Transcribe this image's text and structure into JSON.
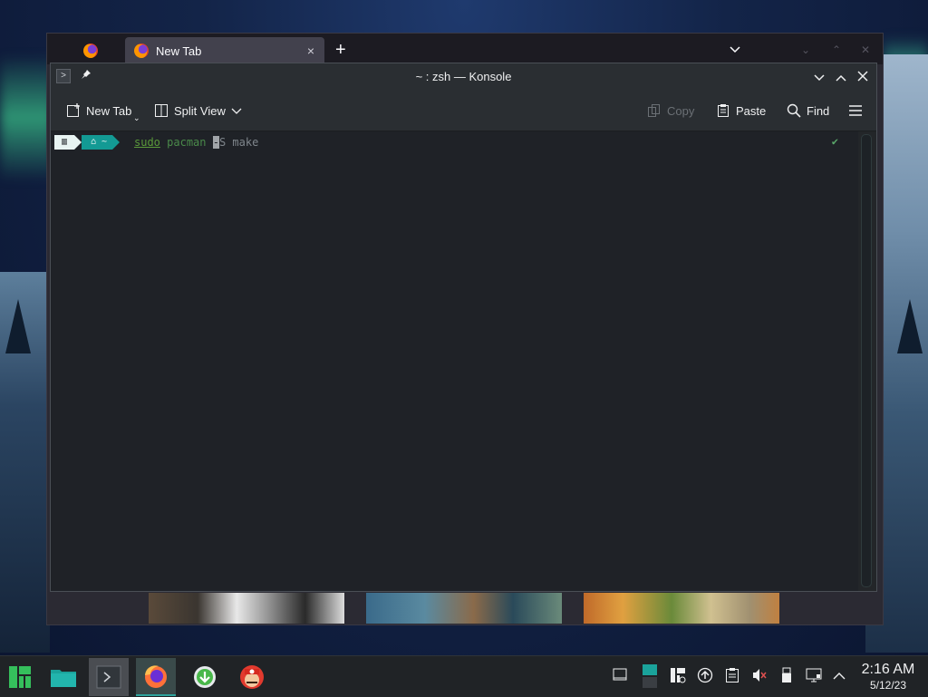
{
  "firefox": {
    "active_tab_label": "New Tab",
    "close_glyph": "×",
    "newtab_glyph": "+",
    "dropdown_glyph": "⌄"
  },
  "konsole": {
    "title": "~ : zsh — Konsole",
    "toolbar": {
      "new_tab_label": "New Tab",
      "split_view_label": "Split View",
      "copy_label": "Copy",
      "paste_label": "Paste",
      "find_label": "Find"
    },
    "terminal": {
      "prompt_home": "⌂ ~",
      "command_sudo": "sudo",
      "command_pacman": "pacman",
      "command_cursor_char": "-",
      "command_args": "S make",
      "status_check": "✔"
    }
  },
  "taskbar": {
    "clock_time": "2:16 AM",
    "clock_date": "5/12/23"
  },
  "colors": {
    "accent": "#139a94",
    "terminal_bg": "#1f2227",
    "window_bg": "#2a2e32"
  }
}
